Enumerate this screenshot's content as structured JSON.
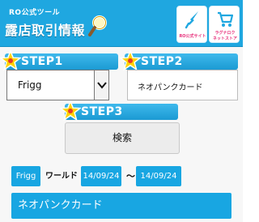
{
  "header": {
    "subtitle": "RO公式ツール",
    "title": "露店取引情報",
    "buttons": [
      {
        "label": "RO公式サイト",
        "icon": "sword-icon"
      },
      {
        "label_line1": "ラグナロク",
        "label_line2": "ネットストア",
        "icon": "shopping-cart-icon"
      }
    ],
    "colors": {
      "header_bg": "#1fa7e0",
      "button_label": "#e7327c"
    }
  },
  "steps": [
    {
      "label": "STEP1"
    },
    {
      "label": "STEP2"
    },
    {
      "label": "STEP3"
    }
  ],
  "form": {
    "server_select": {
      "value": "Frigg"
    },
    "keyword_input": {
      "value": "ネオパンクカード"
    },
    "search_button": {
      "label": "検索"
    }
  },
  "result": {
    "server": "Frigg",
    "word_label": "ワールド",
    "date_from": "14/09/24",
    "separator": "～",
    "date_to": "14/09/24",
    "item_name": "ネオパンクカード",
    "accent_color": "#18a6e2"
  }
}
